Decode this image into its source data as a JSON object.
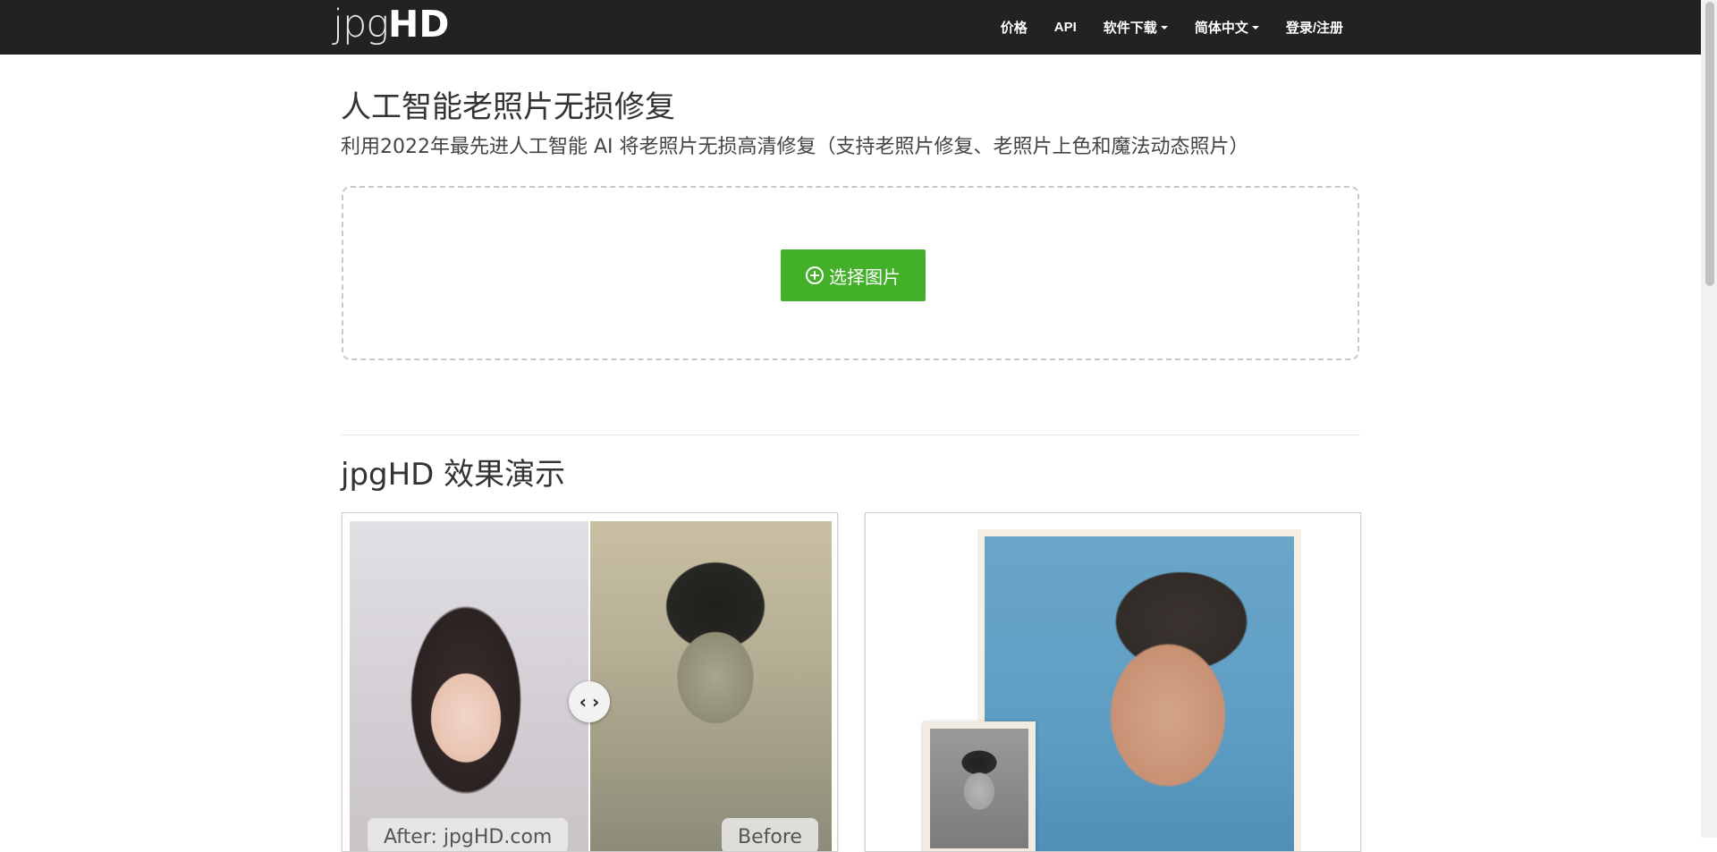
{
  "navbar": {
    "logo_light": "jpg",
    "logo_bold": "HD",
    "items": [
      {
        "label": "价格",
        "has_caret": false
      },
      {
        "label": "API",
        "has_caret": false
      },
      {
        "label": "软件下载",
        "has_caret": true
      },
      {
        "label": "简体中文",
        "has_caret": true
      },
      {
        "label": "登录/注册",
        "has_caret": false
      }
    ]
  },
  "hero": {
    "title": "人工智能老照片无损修复",
    "subtitle": "利用2022年最先进人工智能 AI 将老照片无损高清修复（支持老照片修复、老照片上色和魔法动态照片）",
    "upload_button": "选择图片"
  },
  "demo": {
    "title": "jpgHD 效果演示",
    "left_card": {
      "label_after": "After: jpgHD.com",
      "label_before": "Before",
      "handle_left": "‹",
      "handle_right": "›"
    }
  },
  "colors": {
    "navbar_bg": "#222222",
    "upload_button_bg": "#43b02a"
  }
}
